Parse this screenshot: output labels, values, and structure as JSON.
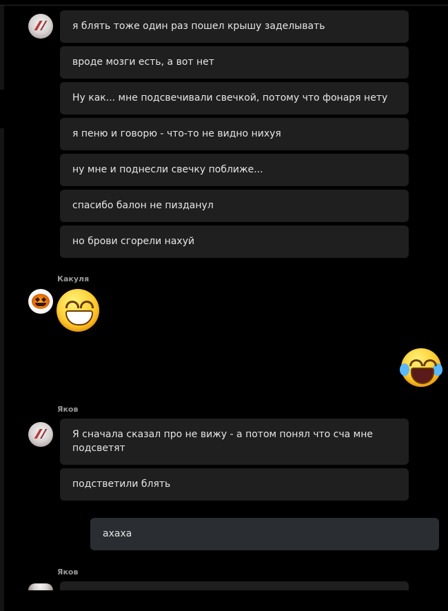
{
  "messages_group_1": {
    "items": [
      "я блять тоже один раз пошел крышу заделывать",
      "вроде мозги есть, а вот нет",
      "Ну как... мне подсвечивали свечкой, потому что фонаря нету",
      "я пеню и говорю - что-то не видно нихуя",
      "ну мне и поднесли свечку поближе...",
      "спасибо балон не пизданул",
      "но брови сгорели нахуй"
    ]
  },
  "sender_2": {
    "name": "Какуля"
  },
  "sender_3": {
    "name": "Яков",
    "items": [
      "Я сначала сказал про не вижу - а потом понял что сча мне подсветят",
      "подстветили блять"
    ]
  },
  "own_message": {
    "text": "ахаха"
  },
  "sender_4": {
    "name": "Яков"
  },
  "icons": {
    "avatar_yakov": "avatar-icon",
    "avatar_kakulya": "pumpkin-avatar-icon",
    "emoji_grin": "grinning-face-emoji",
    "emoji_tears": "face-with-tears-of-joy-emoji"
  },
  "colors": {
    "background": "#000000",
    "bubble": "#1f1f1f",
    "own_bubble": "#2a2e33",
    "text": "#e6e6e6",
    "name": "#9a9a9a"
  }
}
